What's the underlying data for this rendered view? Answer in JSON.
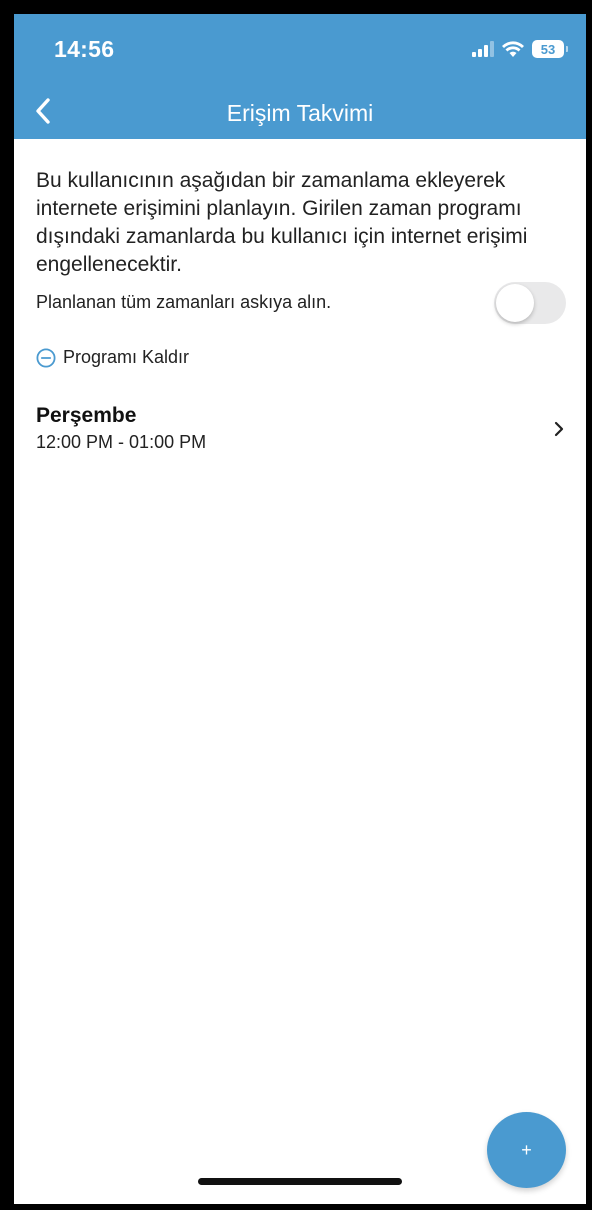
{
  "status_bar": {
    "time": "14:56",
    "battery": "53",
    "icons": [
      "cellular-signal-icon",
      "wifi-icon",
      "battery-icon"
    ]
  },
  "header": {
    "title": "Erişim Takvimi",
    "back_icon": "chevron-left-icon"
  },
  "description": "Bu kullanıcının aşağıdan bir zamanlama ekleyerek internete erişimini planlayın. Girilen zaman programı dışındaki zamanlarda bu kullanıcı için internet erişimi engellenecektir.",
  "pause_all": {
    "label": "Planlanan tüm zamanları askıya alın.",
    "enabled": false
  },
  "remove_program": {
    "label": "Programı Kaldır",
    "icon": "minus-circle-icon"
  },
  "schedules": [
    {
      "day": "Perşembe",
      "time_range": "12:00 PM - 01:00 PM"
    }
  ],
  "fab": {
    "label": "+"
  },
  "colors": {
    "accent": "#4a9ad0",
    "toggle_off": "#e9e9ea"
  }
}
